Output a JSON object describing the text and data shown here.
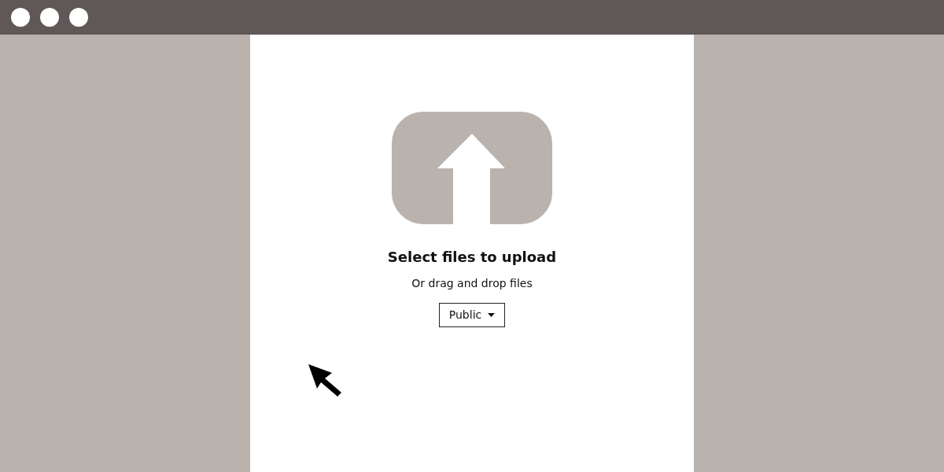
{
  "title": "Select files to upload",
  "subtitle": "Or drag and drop files",
  "visibility": {
    "label": "Public"
  }
}
